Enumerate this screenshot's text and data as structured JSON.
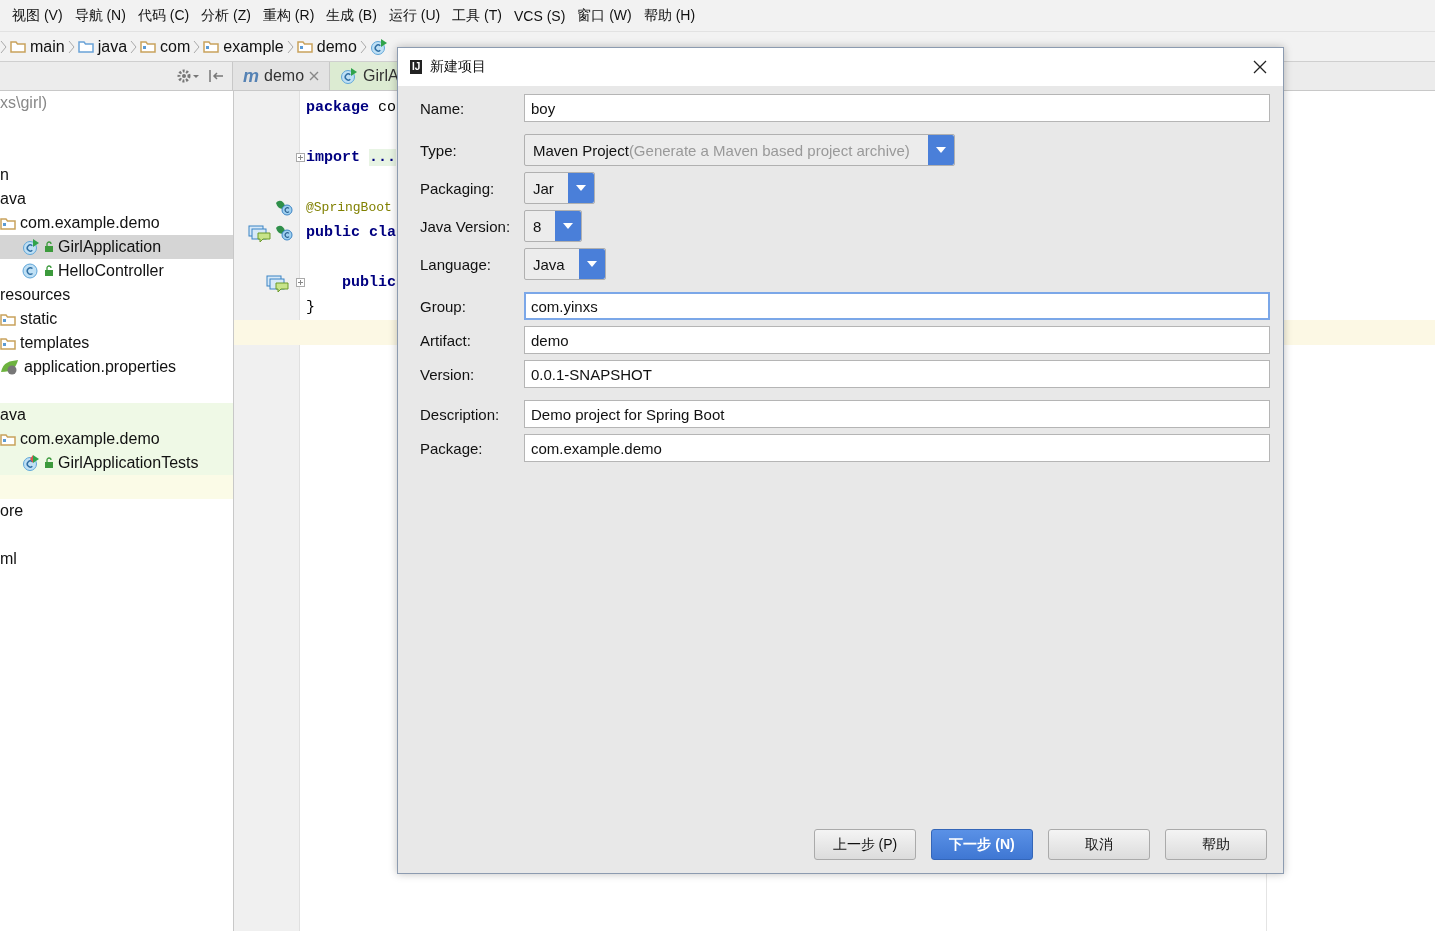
{
  "menu": [
    "视图 (V)",
    "导航 (N)",
    "代码 (C)",
    "分析 (Z)",
    "重构 (R)",
    "生成 (B)",
    "运行 (U)",
    "工具 (T)",
    "VCS (S)",
    "窗口 (W)",
    "帮助 (H)"
  ],
  "breadcrumbs": [
    {
      "label": "main",
      "kind": "folder"
    },
    {
      "label": "java",
      "kind": "source"
    },
    {
      "label": "com",
      "kind": "package"
    },
    {
      "label": "example",
      "kind": "package"
    },
    {
      "label": "demo",
      "kind": "package"
    },
    {
      "kind": "run-class"
    }
  ],
  "editor_tabs": [
    {
      "label": "demo",
      "icon_text": "m",
      "selected": false,
      "closable": true
    },
    {
      "label": "GirlA",
      "kind": "run-class",
      "selected": true,
      "closable": false
    }
  ],
  "project_tree": [
    {
      "label": "xs\\girl)",
      "kind": "root",
      "selected": false,
      "children": [
        {
          "selected": false
        },
        {
          "selected": false,
          "children": [
            {
              "label": "n",
              "selected": false,
              "children": [
                {
                  "label": "ava",
                  "selected": false,
                  "children": [
                    {
                      "label": "com.example.demo",
                      "kind": "package",
                      "selected": false,
                      "children": [
                        {
                          "label": "GirlApplication",
                          "kind": "run-class",
                          "selected": true
                        },
                        {
                          "label": "HelloController",
                          "kind": "class",
                          "selected": false
                        }
                      ]
                    }
                  ]
                },
                {
                  "label": "resources",
                  "selected": false,
                  "children": [
                    {
                      "label": "static",
                      "kind": "package",
                      "selected": false
                    },
                    {
                      "label": "templates",
                      "kind": "package",
                      "selected": false
                    },
                    {
                      "label": "application.properties",
                      "kind": "spring",
                      "selected": false
                    }
                  ]
                }
              ]
            },
            {
              "selected": false,
              "children": [
                {
                  "label": "ava",
                  "selected": false,
                  "color": "#eff9e6",
                  "children": [
                    {
                      "label": "com.example.demo",
                      "kind": "package",
                      "selected": false,
                      "color": "#eff9e6",
                      "children": [
                        {
                          "label": "GirlApplicationTests",
                          "kind": "test-class",
                          "selected": false,
                          "color": "#eff9e6"
                        }
                      ]
                    }
                  ]
                }
              ]
            }
          ]
        },
        {
          "selected": false,
          "color": "#fbfbe7"
        },
        {
          "label": "ore",
          "selected": false
        },
        {
          "selected": false
        },
        {
          "label": "ml",
          "selected": false
        }
      ]
    }
  ],
  "code_lines": [
    {
      "current": false,
      "fold": false,
      "bean": false,
      "implemented": false,
      "segments": [
        {
          "kind": "keyword",
          "text": "package"
        },
        {
          "kind": "plain",
          "text": " co"
        }
      ]
    },
    {
      "current": false,
      "fold": false,
      "bean": false,
      "implemented": false
    },
    {
      "current": false,
      "fold": true,
      "bean": false,
      "implemented": false,
      "segments": [
        {
          "kind": "keyword",
          "text": "import"
        },
        {
          "kind": "folded",
          "text": "..."
        }
      ]
    },
    {
      "current": false,
      "fold": false,
      "bean": false,
      "implemented": false
    },
    {
      "current": false,
      "fold": false,
      "bean": true,
      "implemented": false,
      "segments": [
        {
          "kind": "annotation",
          "text": "@SpringBoot"
        }
      ]
    },
    {
      "current": false,
      "fold": false,
      "bean": true,
      "implemented": true,
      "segments": [
        {
          "kind": "keyword",
          "text": "public cla"
        }
      ]
    },
    {
      "current": false,
      "fold": false,
      "bean": false,
      "implemented": false
    },
    {
      "current": false,
      "fold": true,
      "bean": false,
      "implemented": true,
      "segments": [
        {
          "kind": "keyword",
          "text": "    public"
        }
      ]
    },
    {
      "current": false,
      "fold": false,
      "bean": false,
      "implemented": false,
      "segments": [
        {
          "kind": "plain",
          "text": "}"
        }
      ]
    },
    {
      "current": true,
      "fold": false,
      "bean": false,
      "implemented": false
    }
  ],
  "dialog": {
    "logo": "IJ",
    "title": "新建项目",
    "sections": [
      [
        {
          "label": "Name:",
          "kind": "text",
          "value": "boy",
          "focused": false
        }
      ],
      [
        {
          "label": "Type:",
          "kind": "combo",
          "value": "Maven Project",
          "hint": "(Generate a Maven based project archive)"
        },
        {
          "label": "Packaging:",
          "kind": "combo",
          "value": "Jar"
        },
        {
          "label": "Java Version:",
          "kind": "combo",
          "value": "8"
        },
        {
          "label": "Language:",
          "kind": "combo",
          "value": "Java"
        }
      ],
      [
        {
          "label": "Group:",
          "kind": "text",
          "value": "com.yinxs",
          "focused": true
        },
        {
          "label": "Artifact:",
          "kind": "text",
          "value": "demo",
          "focused": false
        },
        {
          "label": "Version:",
          "kind": "text",
          "value": "0.0.1-SNAPSHOT",
          "focused": false
        }
      ],
      [
        {
          "label": "Description:",
          "kind": "text",
          "value": "Demo project for Spring Boot",
          "focused": false
        },
        {
          "label": "Package:",
          "kind": "text",
          "value": "com.example.demo",
          "focused": false
        }
      ]
    ],
    "buttons": [
      {
        "label": "上一步 (P)",
        "default": false
      },
      {
        "label": "下一步 (N)",
        "default": true
      },
      {
        "label": "取消",
        "default": false
      },
      {
        "label": "帮助",
        "default": false
      }
    ]
  }
}
